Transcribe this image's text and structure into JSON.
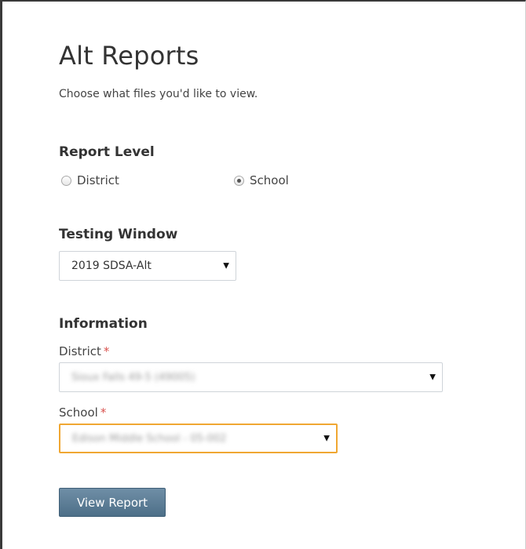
{
  "page": {
    "title": "Alt Reports",
    "subtitle": "Choose what files you'd like to view."
  },
  "report_level": {
    "heading": "Report Level",
    "options": [
      {
        "label": "District",
        "selected": false
      },
      {
        "label": "School",
        "selected": true
      }
    ]
  },
  "testing_window": {
    "heading": "Testing Window",
    "selected": "2019 SDSA-Alt",
    "caret_icon": "caret-down-icon"
  },
  "information": {
    "heading": "Information",
    "district": {
      "label": "District",
      "required_mark": "*",
      "value": "Sioux Falls 49-5 (49005)"
    },
    "school": {
      "label": "School",
      "required_mark": "*",
      "value": "Edison Middle School - 05-002"
    }
  },
  "actions": {
    "view_report_label": "View Report"
  },
  "colors": {
    "focus_border": "#f0a732",
    "required": "#d9534f",
    "button": "#5a7b94"
  }
}
